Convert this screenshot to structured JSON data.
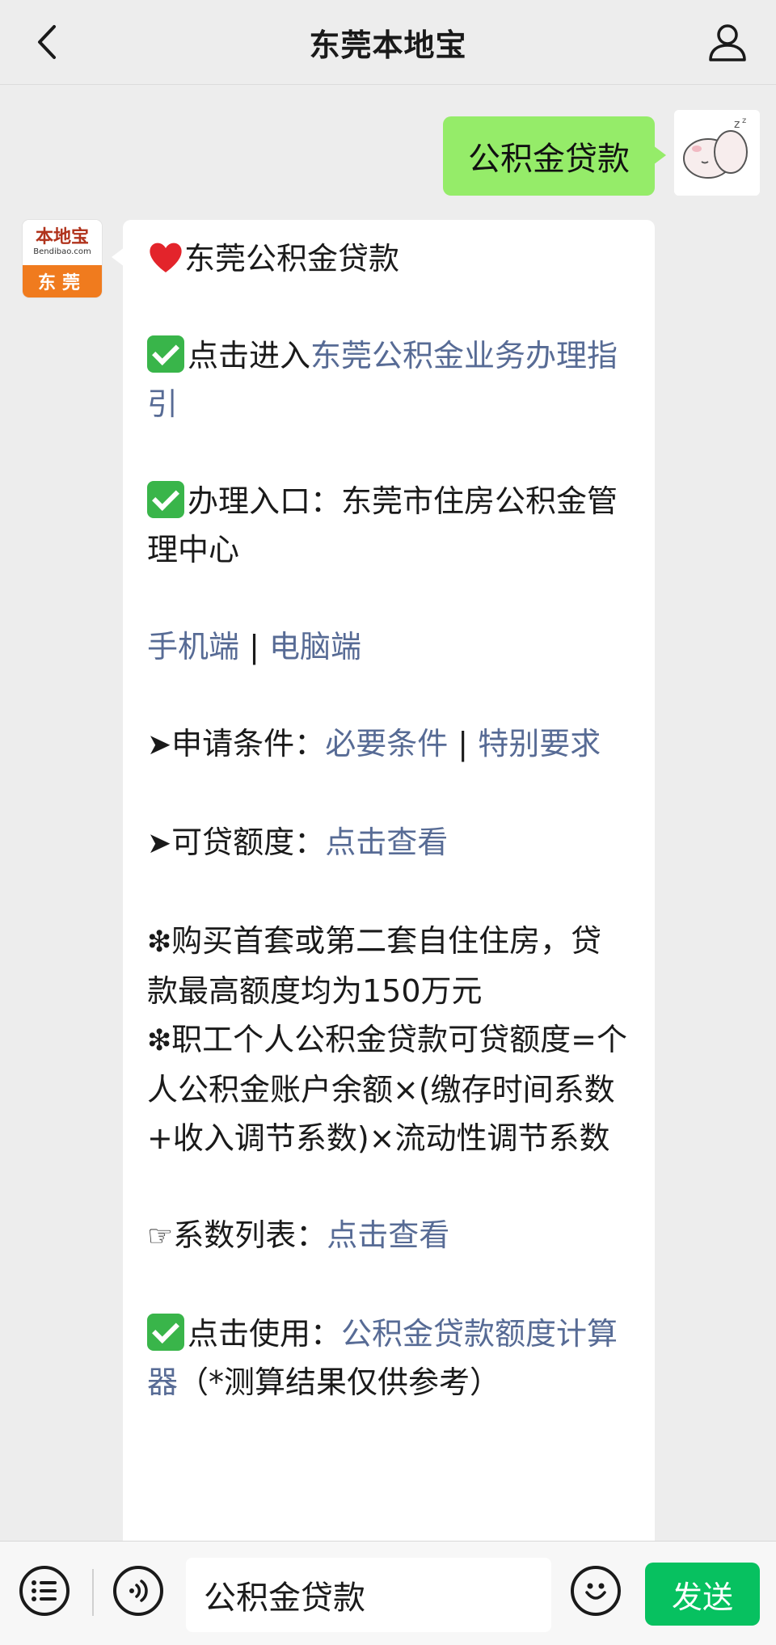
{
  "header": {
    "title": "东莞本地宝",
    "back_icon": "chevron-left-icon",
    "user_icon": "person-icon"
  },
  "user_message": {
    "text": "公积金贷款",
    "bubble_color": "#95ec69"
  },
  "bot": {
    "avatar": {
      "logo_text": "本地宝",
      "logo_sub": "Bendibao.com",
      "city": "东莞"
    },
    "title": "东莞公积金贷款",
    "guide_prefix": "点击进入",
    "guide_link": "东莞公积金业务办理指引",
    "entry_prefix": "办理入口：",
    "entry_text": "东莞市住房公积金管理中心",
    "mobile_link": "手机端",
    "separator": "|",
    "pc_link": "电脑端",
    "conditions_prefix": "申请条件：",
    "conditions_link1": "必要条件",
    "conditions_link2": "特别要求",
    "quota_prefix": "可贷额度：",
    "quota_link": "点击查看",
    "note1": "购买首套或第二套自住住房，贷款最高额度均为150万元",
    "note2": "职工个人公积金贷款可贷额度=个人公积金账户余额×(缴存时间系数+收入调节系数)×流动性调节系数",
    "coef_prefix": "系数列表：",
    "coef_link": "点击查看",
    "calc_prefix": "点击使用：",
    "calc_link": "公积金贷款额度计算器",
    "calc_suffix": "（*测算结果仅供参考）",
    "link_color": "#576b95"
  },
  "bottom_bar": {
    "input_value": "公积金贷款",
    "send_label": "发送",
    "menu_icon": "list-icon",
    "voice_icon": "voice-icon",
    "emoji_icon": "smiley-icon",
    "send_color": "#07c160"
  }
}
